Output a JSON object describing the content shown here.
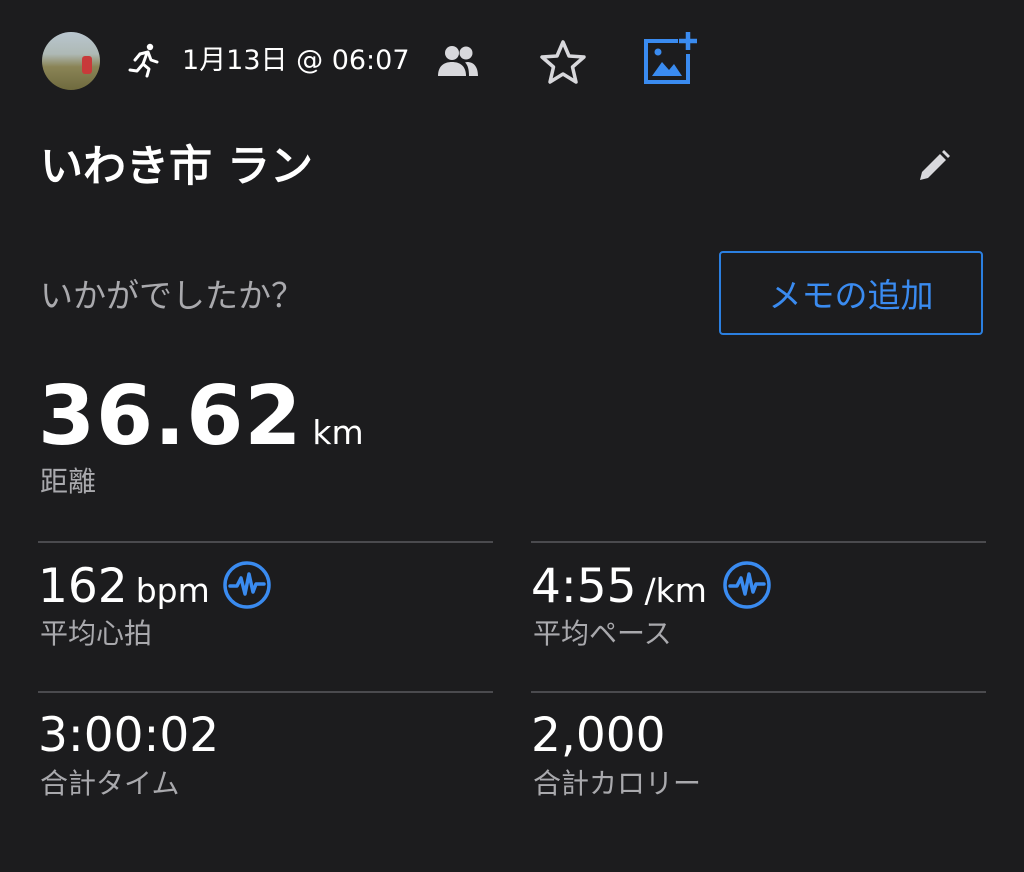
{
  "header": {
    "date": "1月13日 @ 06:07",
    "icons": [
      "avatar",
      "running-icon",
      "people-icon",
      "star-icon",
      "add-photo-icon"
    ]
  },
  "activity": {
    "title": "いわき市 ラン",
    "prompt": "いかがでしたか？",
    "memo_button": "メモの追加"
  },
  "distance": {
    "value": "36.62",
    "unit": "km",
    "label": "距離"
  },
  "metrics": {
    "heart_rate": {
      "value": "162",
      "unit": "bpm",
      "label": "平均心拍"
    },
    "pace": {
      "value": "4:55",
      "unit": "/km",
      "label": "平均ペース"
    },
    "total_time": {
      "value": "3:00:02",
      "label": "合計タイム"
    },
    "calories": {
      "value": "2,000",
      "label": "合計カロリー"
    }
  },
  "colors": {
    "background": "#1c1c1e",
    "accent": "#3a8bf0",
    "label_gray": "#a9a9ad",
    "divider": "#4a4a4e"
  }
}
